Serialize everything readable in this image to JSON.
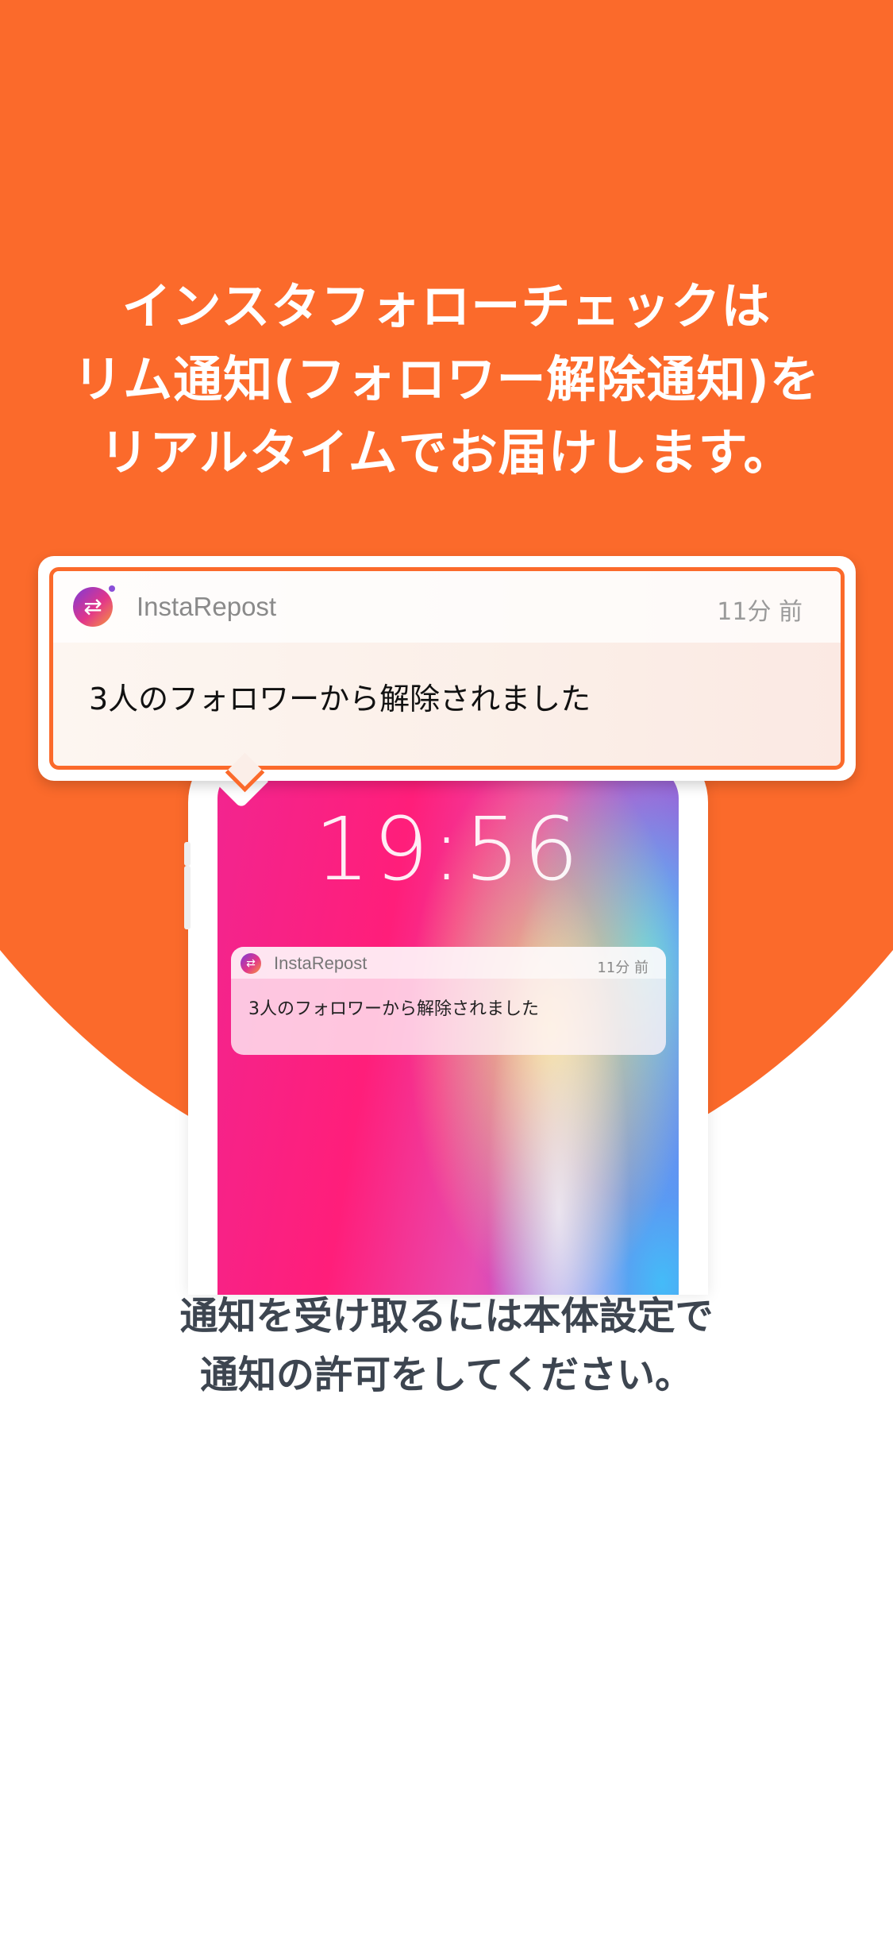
{
  "headline": {
    "line1": "インスタフォローチェックは",
    "line2": "リム通知(フォロワー解除通知)を",
    "line3": "リアルタイムでお届けします。"
  },
  "callout": {
    "app_name": "InstaRepost",
    "time": "11分 前",
    "message": "3人のフォロワーから解除されました"
  },
  "phone": {
    "clock": "19:56",
    "notification": {
      "app_name": "InstaRepost",
      "time": "11分 前",
      "message": "3人のフォロワーから解除されました"
    }
  },
  "footer": {
    "line1": "通知を受け取るには本体設定で",
    "line2": "通知の許可をしてください。"
  },
  "colors": {
    "accent": "#fb6a2b",
    "footer_text": "#3d4550"
  },
  "icons": {
    "app": "repost-arrows-icon"
  }
}
